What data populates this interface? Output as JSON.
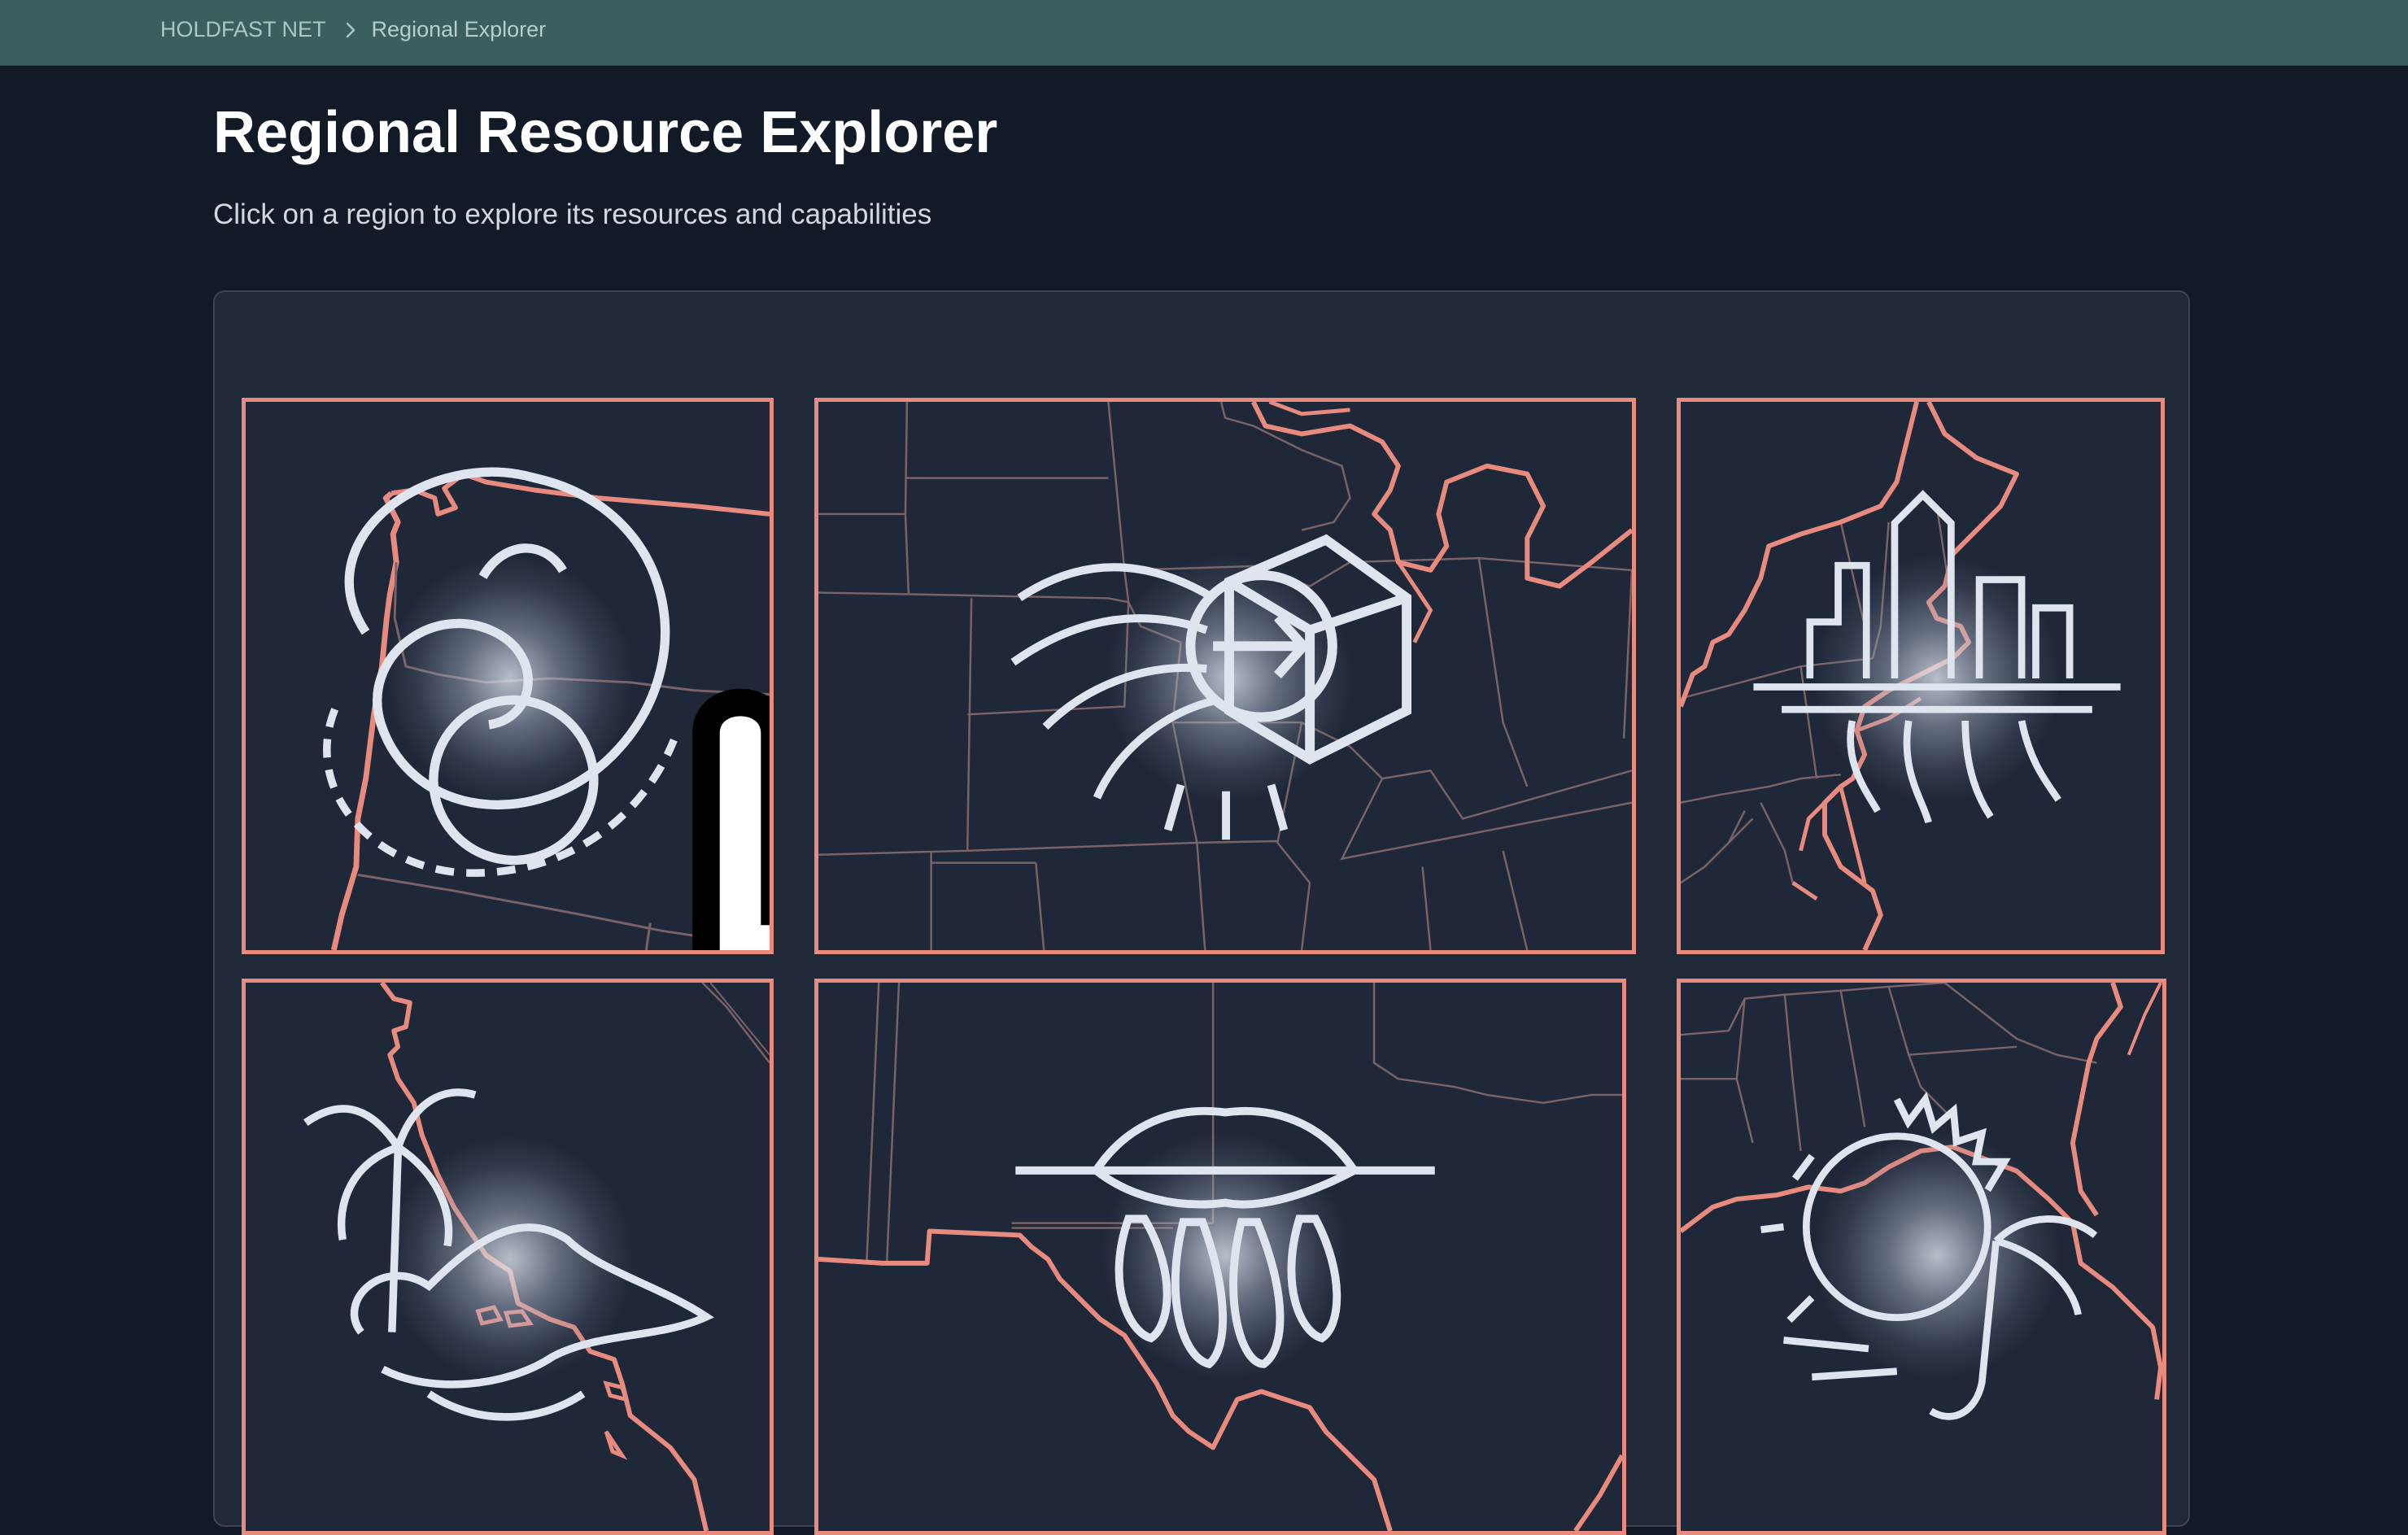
{
  "breadcrumb": {
    "root": "HOLDFAST NET",
    "current": "Regional Explorer",
    "separator_icon": "chevron-right-icon"
  },
  "page": {
    "title": "Regional Resource Explorer",
    "subtitle": "Click on a region to explore its resources and capabilities"
  },
  "regions": [
    {
      "id": "pacific-northwest",
      "emblem_icon": "spiral-wave-icon"
    },
    {
      "id": "midwest",
      "emblem_icon": "feathered-package-icon"
    },
    {
      "id": "northeast",
      "emblem_icon": "city-skyline-icon"
    },
    {
      "id": "california",
      "emblem_icon": "palm-island-icon"
    },
    {
      "id": "southwest",
      "emblem_icon": "oil-seed-icon"
    },
    {
      "id": "southeast",
      "emblem_icon": "sun-palm-icon"
    }
  ],
  "colors": {
    "topbar": "#3a5f5c",
    "background": "#131a27",
    "panel": "#202938",
    "map_border": "#e88b7e",
    "state_lines": "#7a6266",
    "emblem_stroke": "#dfe5ee"
  }
}
